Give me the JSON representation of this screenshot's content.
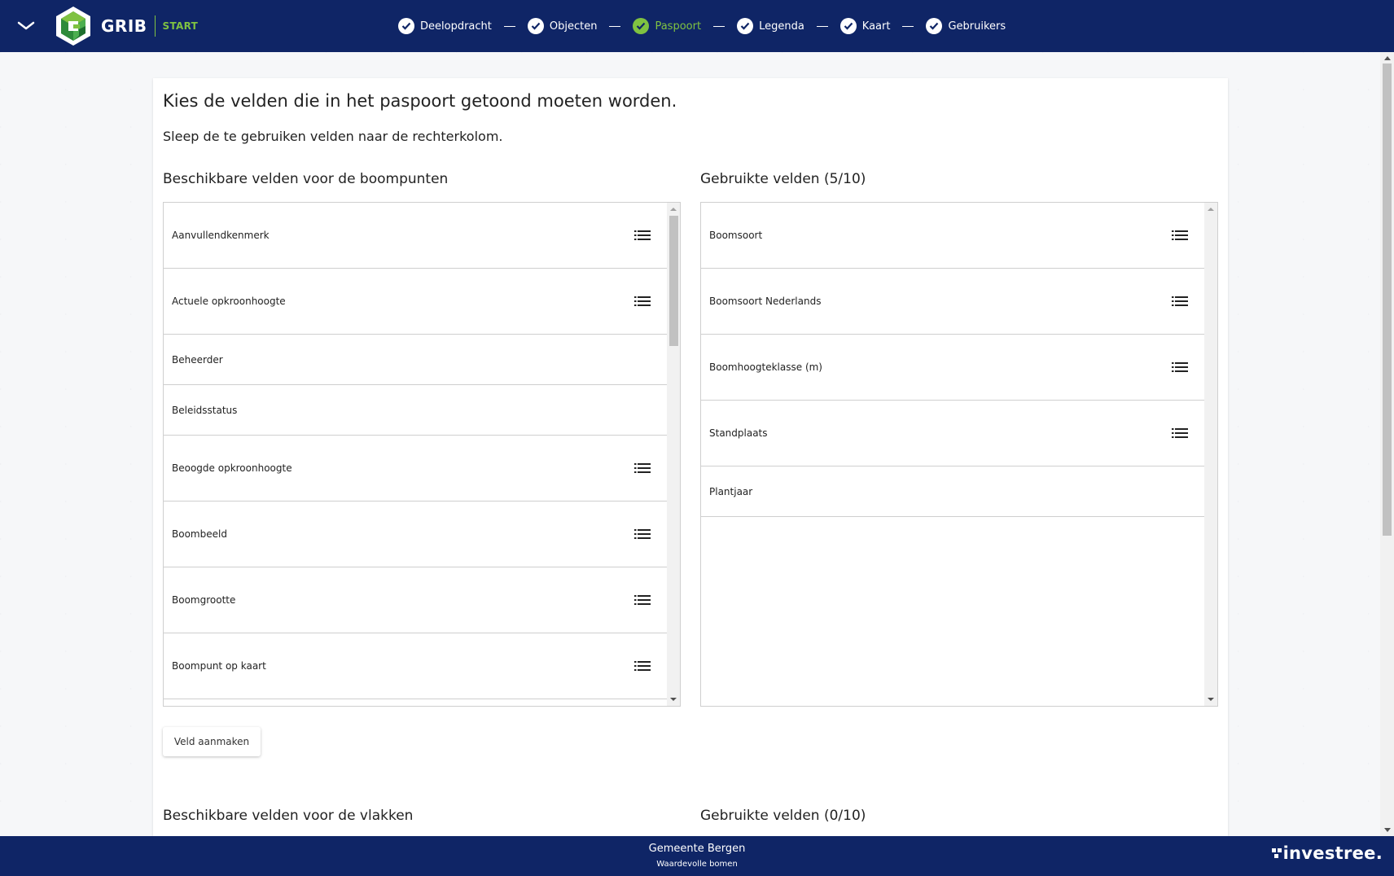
{
  "header": {
    "logo_text": "GRIB",
    "start_label": "START",
    "steps": [
      {
        "label": "Deelopdracht",
        "active": false
      },
      {
        "label": "Objecten",
        "active": false
      },
      {
        "label": "Paspoort",
        "active": true
      },
      {
        "label": "Legenda",
        "active": false
      },
      {
        "label": "Kaart",
        "active": false
      },
      {
        "label": "Gebruikers",
        "active": false
      }
    ]
  },
  "main": {
    "title": "Kies de velden die in het paspoort getoond moeten worden.",
    "subtitle": "Sleep de te gebruiken velden naar de rechterkolom.",
    "boompunten": {
      "available_heading": "Beschikbare velden voor de boompunten",
      "used_heading": "Gebruikte velden (5/10)",
      "available_fields": [
        {
          "label": "Aanvullendkenmerk",
          "handle": true
        },
        {
          "label": "Actuele opkroonhoogte",
          "handle": true
        },
        {
          "label": "Beheerder",
          "handle": false
        },
        {
          "label": "Beleidsstatus",
          "handle": false
        },
        {
          "label": "Beoogde opkroonhoogte",
          "handle": true
        },
        {
          "label": "Boombeeld",
          "handle": true
        },
        {
          "label": "Boomgrootte",
          "handle": true
        },
        {
          "label": "Boompunt op kaart",
          "handle": true
        }
      ],
      "used_fields": [
        {
          "label": "Boomsoort",
          "handle": true
        },
        {
          "label": "Boomsoort Nederlands",
          "handle": true
        },
        {
          "label": "Boomhoogteklasse (m)",
          "handle": true
        },
        {
          "label": "Standplaats",
          "handle": true
        },
        {
          "label": "Plantjaar",
          "handle": false
        }
      ],
      "create_button": "Veld aanmaken"
    },
    "vlakken": {
      "available_heading": "Beschikbare velden voor de vlakken",
      "used_heading": "Gebruikte velden (0/10)"
    }
  },
  "footer": {
    "org": "Gemeente Bergen",
    "app": "Waardevolle bomen",
    "brand": "investree."
  },
  "colors": {
    "navy": "#0f2566",
    "green": "#7fc241"
  },
  "icons": {
    "collapse": "chevron-down-icon",
    "step": "check-circle-icon",
    "handle": "drag-handle-icon"
  }
}
